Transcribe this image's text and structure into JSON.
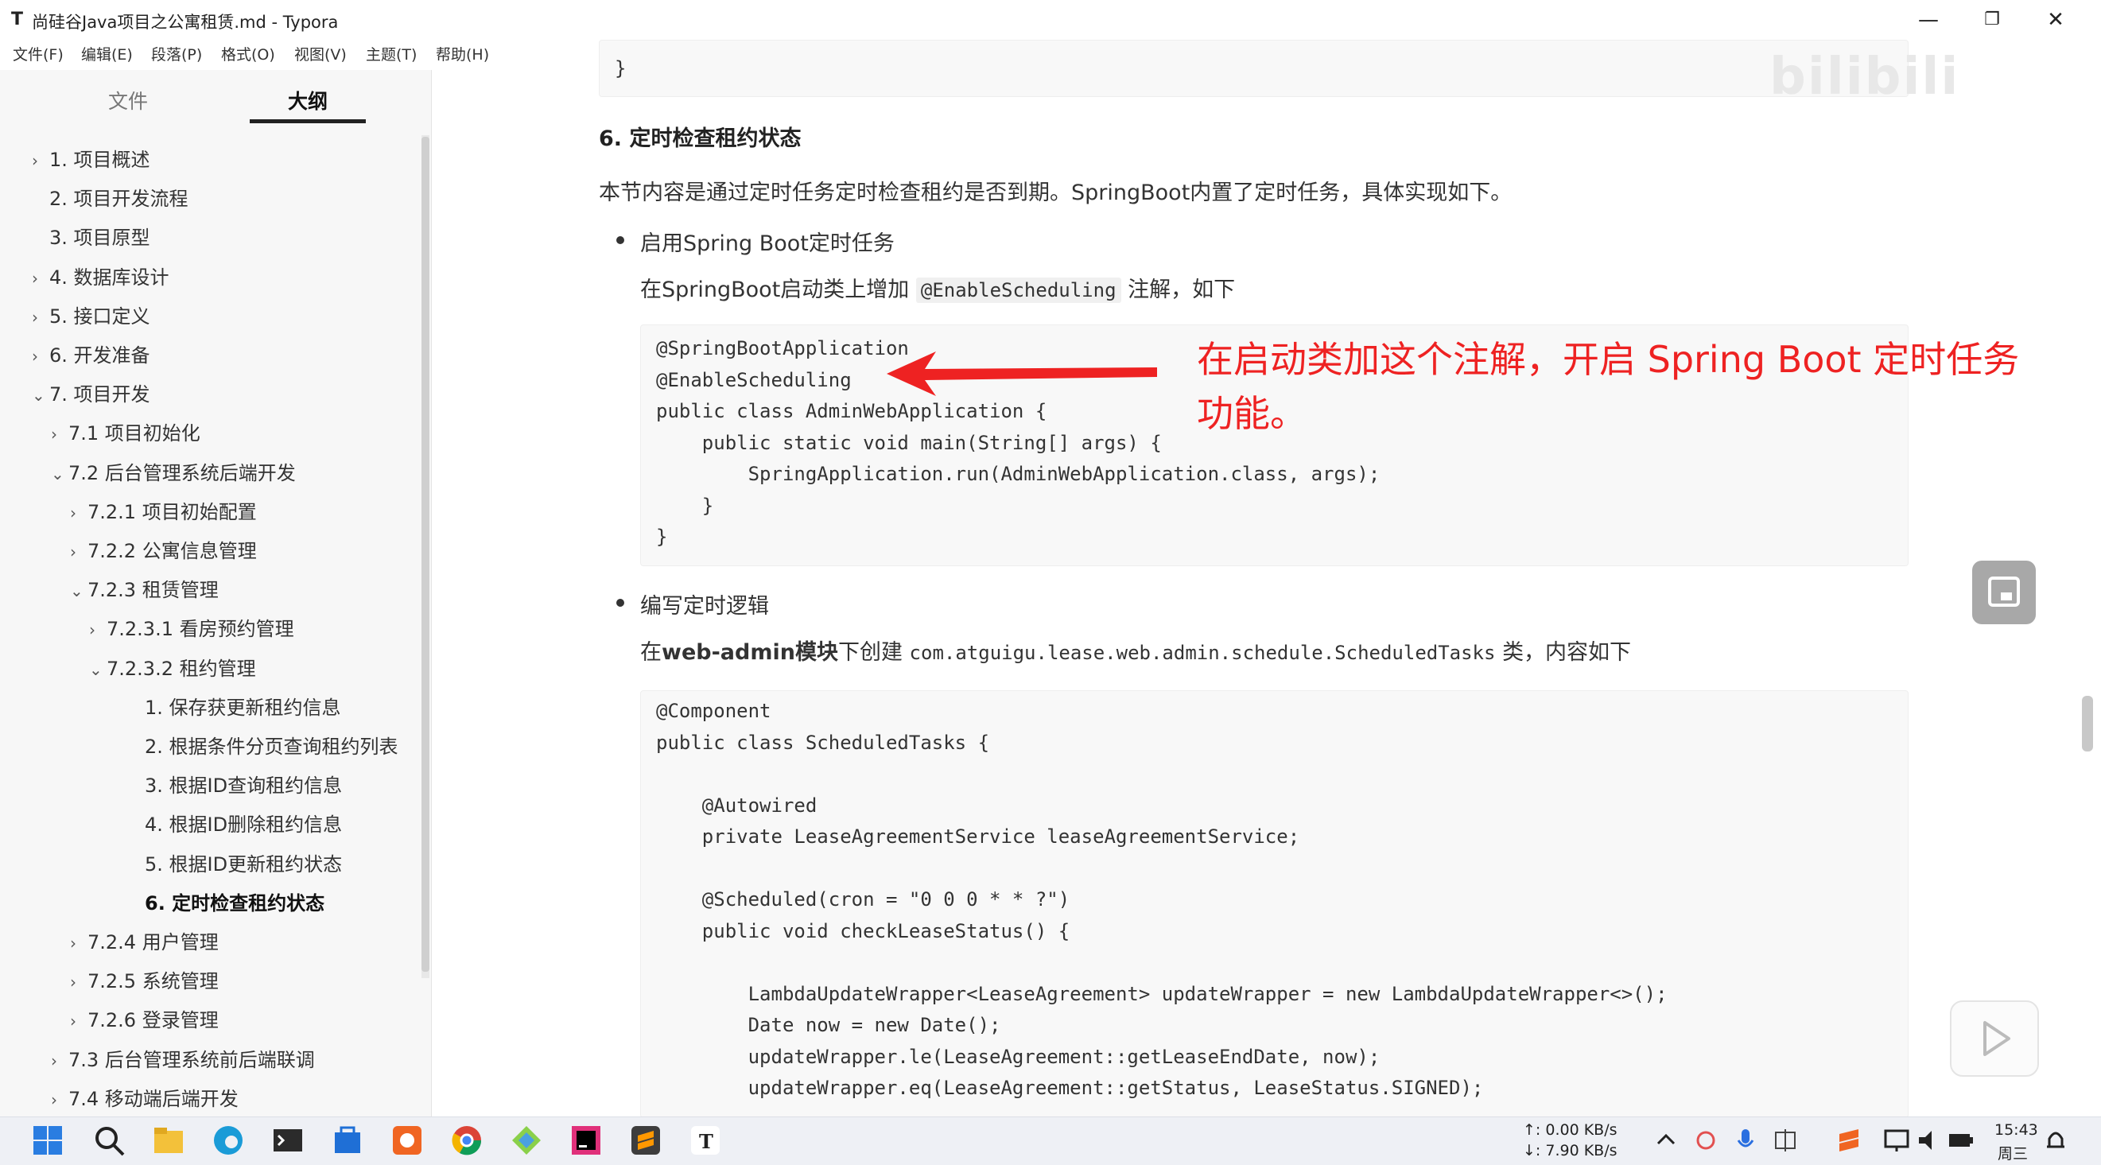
{
  "window": {
    "app_icon": "T",
    "title": "尚硅谷Java项目之公寓租赁.md - Typora",
    "minimize": "—",
    "maximize": "❐",
    "close": "✕"
  },
  "menu": [
    "文件(F)",
    "编辑(E)",
    "段落(P)",
    "格式(O)",
    "视图(V)",
    "主题(T)",
    "帮助(H)"
  ],
  "sidebar": {
    "tabs": [
      "文件",
      "大纲"
    ],
    "active_tab": "大纲",
    "outline": [
      {
        "label": "1. 项目概述",
        "chevron": "›",
        "level": 0
      },
      {
        "label": "2. 项目开发流程",
        "chevron": "",
        "level": 0
      },
      {
        "label": "3. 项目原型",
        "chevron": "",
        "level": 0
      },
      {
        "label": "4. 数据库设计",
        "chevron": "›",
        "level": 0
      },
      {
        "label": "5. 接口定义",
        "chevron": "›",
        "level": 0
      },
      {
        "label": "6. 开发准备",
        "chevron": "›",
        "level": 0
      },
      {
        "label": "7. 项目开发",
        "chevron": "⌄",
        "level": 0
      },
      {
        "label": "7.1 项目初始化",
        "chevron": "›",
        "level": 1
      },
      {
        "label": "7.2 后台管理系统后端开发",
        "chevron": "⌄",
        "level": 1
      },
      {
        "label": "7.2.1 项目初始配置",
        "chevron": "›",
        "level": 2
      },
      {
        "label": "7.2.2 公寓信息管理",
        "chevron": "›",
        "level": 2
      },
      {
        "label": "7.2.3 租赁管理",
        "chevron": "⌄",
        "level": 2
      },
      {
        "label": "7.2.3.1 看房预约管理",
        "chevron": "›",
        "level": 3
      },
      {
        "label": "7.2.3.2 租约管理",
        "chevron": "⌄",
        "level": 3
      },
      {
        "label": "1. 保存获更新租约信息",
        "chevron": "",
        "level": 4
      },
      {
        "label": "2. 根据条件分页查询租约列表",
        "chevron": "",
        "level": 4
      },
      {
        "label": "3. 根据ID查询租约信息",
        "chevron": "",
        "level": 4
      },
      {
        "label": "4. 根据ID删除租约信息",
        "chevron": "",
        "level": 4
      },
      {
        "label": "5. 根据ID更新租约状态",
        "chevron": "",
        "level": 4
      },
      {
        "label": "6. 定时检查租约状态",
        "chevron": "",
        "level": 4,
        "active": true
      },
      {
        "label": "7.2.4 用户管理",
        "chevron": "›",
        "level": 2
      },
      {
        "label": "7.2.5 系统管理",
        "chevron": "›",
        "level": 2
      },
      {
        "label": "7.2.6 登录管理",
        "chevron": "›",
        "level": 2
      },
      {
        "label": "7.3 后台管理系统前后端联调",
        "chevron": "›",
        "level": 1
      },
      {
        "label": "7.4 移动端后端开发",
        "chevron": "›",
        "level": 1
      }
    ]
  },
  "doc": {
    "top_brace": "}",
    "heading": "6. 定时检查租约状态",
    "intro": "本节内容是通过定时任务定时检查租约是否到期。SpringBoot内置了定时任务，具体实现如下。",
    "bullet1": "启用Spring Boot定时任务",
    "para1_a": "在SpringBoot启动类上增加",
    "para1_code": "@EnableScheduling",
    "para1_b": "注解，如下",
    "code1": [
      "@SpringBootApplication",
      "@EnableScheduling",
      "public class AdminWebApplication {",
      "    public static void main(String[] args) {",
      "        SpringApplication.run(AdminWebApplication.class, args);",
      "    }",
      "}"
    ],
    "bullet2": "编写定时逻辑",
    "para2_a": "在",
    "para2_bold": "web-admin模块",
    "para2_b": "下创建",
    "para2_code": "com.atguigu.lease.web.admin.schedule.ScheduledTasks",
    "para2_c": "类，内容如下",
    "code2": [
      "@Component",
      "public class ScheduledTasks {",
      "",
      "    @Autowired",
      "    private LeaseAgreementService leaseAgreementService;",
      "",
      "    @Scheduled(cron = \"0 0 0 * * ?\")",
      "    public void checkLeaseStatus() {",
      "",
      "        LambdaUpdateWrapper<LeaseAgreement> updateWrapper = new LambdaUpdateWrapper<>();",
      "        Date now = new Date();",
      "        updateWrapper.le(LeaseAgreement::getLeaseEndDate, now);",
      "        updateWrapper.eq(LeaseAgreement::getStatus, LeaseStatus.SIGNED);"
    ]
  },
  "annotation": "在启动类加这个注解，开启 Spring Boot 定时任务功能。",
  "watermark": "bilibili",
  "taskbar": {
    "net_up": "↑: 0.00 KB/s",
    "net_down": "↓: 7.90 KB/s",
    "time": "15:43",
    "day": "周三"
  },
  "colors": {
    "accent_red": "#ee2222",
    "keyword": "#7a3e9d",
    "type": "#1e5aa8"
  }
}
